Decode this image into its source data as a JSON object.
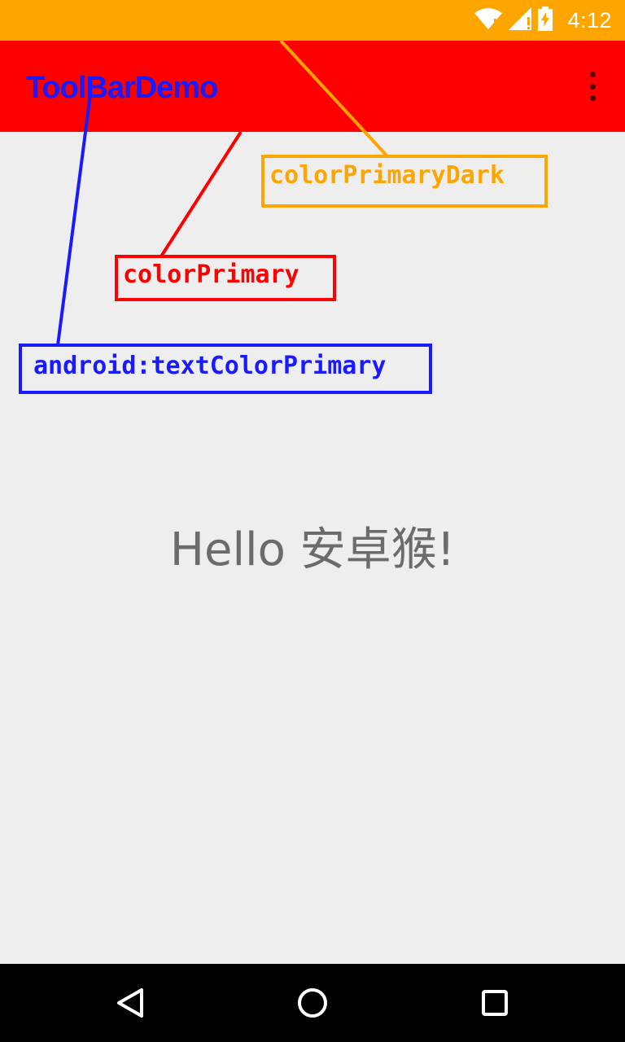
{
  "status_bar": {
    "time": "4:12",
    "background_color": "#ffa500",
    "icons": [
      "wifi-icon",
      "cell-signal-icon",
      "battery-charging-icon"
    ]
  },
  "toolbar": {
    "title": "ToolBarDemo",
    "background_color": "#ff0000",
    "title_color": "#1a1aff",
    "menu_icon": "overflow-menu-icon"
  },
  "annotations": {
    "color_primary_dark": {
      "label": "colorPrimaryDark",
      "color": "#ffa500"
    },
    "color_primary": {
      "label": "colorPrimary",
      "color": "#ff0000"
    },
    "text_color_primary": {
      "label": "android:textColorPrimary",
      "color": "#1a1aff"
    }
  },
  "content": {
    "greeting": "Hello 安卓猴!",
    "background_color": "#eeeeee",
    "text_color": "#6b6b6b"
  },
  "nav_bar": {
    "buttons": [
      "back-icon",
      "home-icon",
      "recents-icon"
    ]
  }
}
